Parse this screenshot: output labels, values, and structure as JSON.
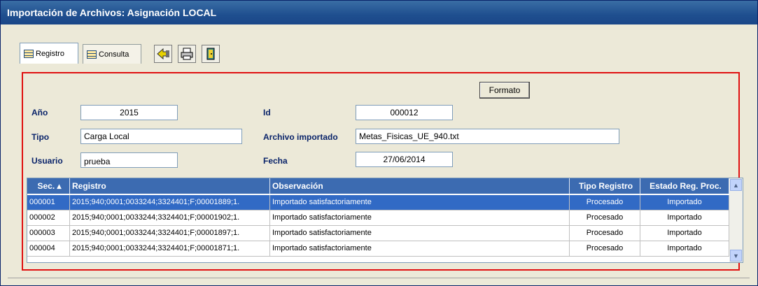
{
  "window": {
    "title": "Importación de Archivos: Asignación LOCAL"
  },
  "tabs": [
    {
      "label": "Registro"
    },
    {
      "label": "Consulta"
    }
  ],
  "toolbar": {
    "icons": [
      "import-icon",
      "printer-icon",
      "exit-door-icon"
    ]
  },
  "form": {
    "formato_label": "Formato",
    "anio": {
      "label": "Año",
      "value": "2015"
    },
    "id": {
      "label": "Id",
      "value": "000012"
    },
    "tipo": {
      "label": "Tipo",
      "value": "Carga Local"
    },
    "archivo": {
      "label": "Archivo importado",
      "value": "Metas_Fisicas_UE_940.txt"
    },
    "usuario": {
      "label": "Usuario",
      "value": "prueba"
    },
    "fecha": {
      "label": "Fecha",
      "value": "27/06/2014"
    }
  },
  "grid": {
    "columns": [
      "Sec. ▴",
      "Registro",
      "Observación",
      "Tipo Registro",
      "Estado Reg. Proc."
    ],
    "rows": [
      {
        "sec": "000001",
        "registro": "2015;940;0001;0033244;3324401;F;00001889;1.",
        "observacion": "Importado satisfactoriamente",
        "tipo": "Procesado",
        "estado": "Importado"
      },
      {
        "sec": "000002",
        "registro": "2015;940;0001;0033244;3324401;F;00001902;1.",
        "observacion": "Importado satisfactoriamente",
        "tipo": "Procesado",
        "estado": "Importado"
      },
      {
        "sec": "000003",
        "registro": "2015;940;0001;0033244;3324401;F;00001897;1.",
        "observacion": "Importado satisfactoriamente",
        "tipo": "Procesado",
        "estado": "Importado"
      },
      {
        "sec": "000004",
        "registro": "2015;940;0001;0033244;3324401;F;00001871;1.",
        "observacion": "Importado satisfactoriamente",
        "tipo": "Procesado",
        "estado": "Importado"
      }
    ],
    "selected_row": 0
  },
  "colors": {
    "title": "#1f4f8f",
    "highlight": "#316ac5",
    "frame": "#e01010"
  }
}
